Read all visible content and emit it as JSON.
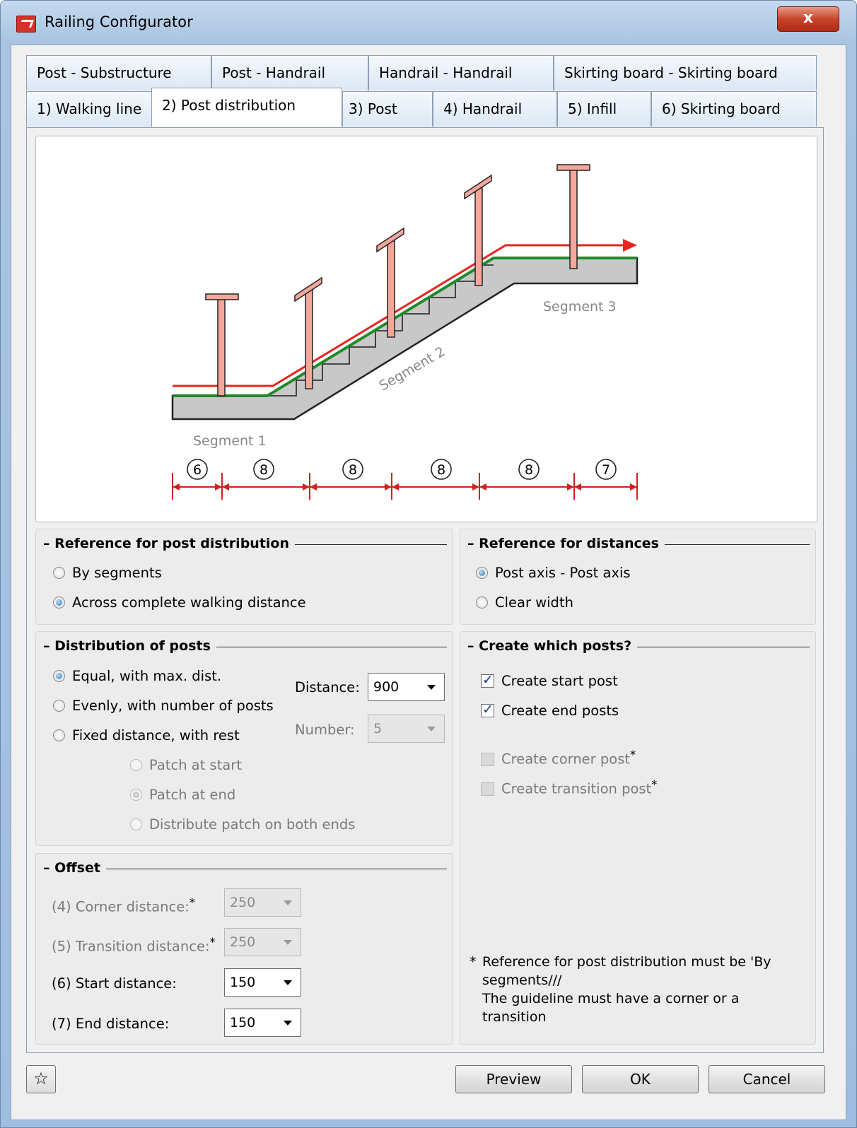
{
  "window": {
    "title": "Railing Configurator",
    "close_glyph": "x"
  },
  "tabs_top": [
    {
      "label": "Post - Substructure"
    },
    {
      "label": "Post - Handrail"
    },
    {
      "label": "Handrail - Handrail"
    },
    {
      "label": "Skirting board - Skirting board"
    }
  ],
  "tabs_bottom": [
    {
      "label": "1) Walking line"
    },
    {
      "label": "2) Post distribution",
      "active": true
    },
    {
      "label": "3) Post"
    },
    {
      "label": "4) Handrail"
    },
    {
      "label": "5) Infill"
    },
    {
      "label": "6) Skirting board"
    }
  ],
  "illustration": {
    "segment_labels": [
      "Segment 1",
      "Segment 2",
      "Segment 3"
    ],
    "dimension_numbers": [
      "6",
      "8",
      "8",
      "8",
      "8",
      "7"
    ]
  },
  "reference_post_distribution": {
    "title": "Reference for post distribution",
    "options": [
      {
        "label": "By segments",
        "selected": false
      },
      {
        "label": "Across complete walking distance",
        "selected": true
      }
    ]
  },
  "reference_distances": {
    "title": "Reference for distances",
    "options": [
      {
        "label": "Post axis - Post axis",
        "selected": true
      },
      {
        "label": "Clear width",
        "selected": false
      }
    ]
  },
  "distribution": {
    "title": "Distribution of posts",
    "options": [
      {
        "label": "Equal, with max. dist.",
        "selected": true
      },
      {
        "label": "Evenly, with number of posts",
        "selected": false
      },
      {
        "label": "Fixed distance, with rest",
        "selected": false
      }
    ],
    "sub_options": [
      {
        "label": "Patch at start",
        "selected": false
      },
      {
        "label": "Patch at end",
        "selected": true
      },
      {
        "label": "Distribute patch on both ends",
        "selected": false
      }
    ],
    "distance_label": "Distance:",
    "distance_value": "900",
    "number_label": "Number:",
    "number_value": "5"
  },
  "create_posts": {
    "title": "Create which posts?",
    "items": [
      {
        "label": "Create start post",
        "checked": true,
        "enabled": true
      },
      {
        "label": "Create end posts",
        "checked": true,
        "enabled": true
      },
      {
        "label": "Create corner post",
        "checked": false,
        "enabled": false,
        "mark": "*"
      },
      {
        "label": "Create transition post",
        "checked": false,
        "enabled": false,
        "mark": "*"
      }
    ]
  },
  "offset": {
    "title": "Offset",
    "rows": [
      {
        "label": "(4) Corner distance:",
        "mark": "*",
        "value": "250",
        "enabled": false
      },
      {
        "label": "(5) Transition distance:",
        "mark": "*",
        "value": "250",
        "enabled": false
      },
      {
        "label": "(6) Start distance:",
        "mark": "",
        "value": "150",
        "enabled": true
      },
      {
        "label": "(7) End distance:",
        "mark": "",
        "value": "150",
        "enabled": true
      }
    ]
  },
  "footnote": {
    "star": "*",
    "line1": "Reference for post distribution must be 'By segments///",
    "line2": "The guideline must have a corner or a transition"
  },
  "buttons": {
    "favorite_glyph": "☆",
    "preview": "Preview",
    "ok": "OK",
    "cancel": "Cancel"
  },
  "colors": {
    "handrail": "#e8231f",
    "walkline": "#1f8a2a",
    "post_fill": "#f4a79a",
    "stair": "#c8c8c8",
    "dimension": "#d41f1f"
  }
}
